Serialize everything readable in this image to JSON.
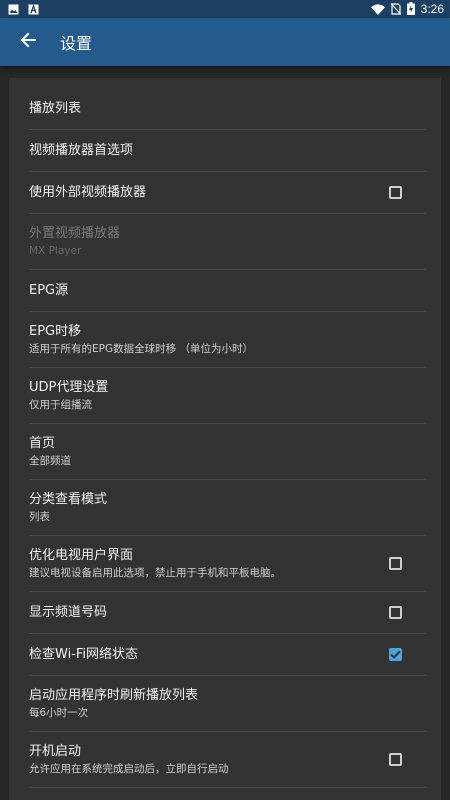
{
  "status_bar": {
    "time": "3:26",
    "left_icons": [
      "image-icon",
      "font-icon"
    ],
    "right_icons": [
      "wifi-icon",
      "no-sim-icon",
      "battery-charging-icon"
    ]
  },
  "app_bar": {
    "title": "设置",
    "back_icon": "arrow-back-icon",
    "background": "#255a8c"
  },
  "settings": [
    {
      "title": "播放列表"
    },
    {
      "title": "视频播放器首选项"
    },
    {
      "title": "使用外部视频播放器",
      "checkbox": false
    },
    {
      "title": "外置视频播放器",
      "subtitle": "MX Player",
      "disabled": true
    },
    {
      "title": "EPG源"
    },
    {
      "title": "EPG时移",
      "subtitle": "适用于所有的EPG数据全球时移 （单位为小时）"
    },
    {
      "title": "UDP代理设置",
      "subtitle": "仅用于组播流"
    },
    {
      "title": "首页",
      "subtitle": "全部频道"
    },
    {
      "title": "分类查看模式",
      "subtitle": "列表"
    },
    {
      "title": "优化电视用户界面",
      "subtitle": "建议电视设备启用此选项，禁止用于手机和平板电脑。",
      "checkbox": false
    },
    {
      "title": "显示频道号码",
      "checkbox": false
    },
    {
      "title": "检查Wi-Fi网络状态",
      "checkbox": true
    },
    {
      "title": "启动应用程序时刷新播放列表",
      "subtitle": "每6小时一次"
    },
    {
      "title": "开机启动",
      "subtitle": "允许应用在系统完成启动后，立即自行启动",
      "checkbox": false
    }
  ],
  "colors": {
    "accent": "#4ea3df",
    "card": "#333333",
    "background": "#262626"
  }
}
